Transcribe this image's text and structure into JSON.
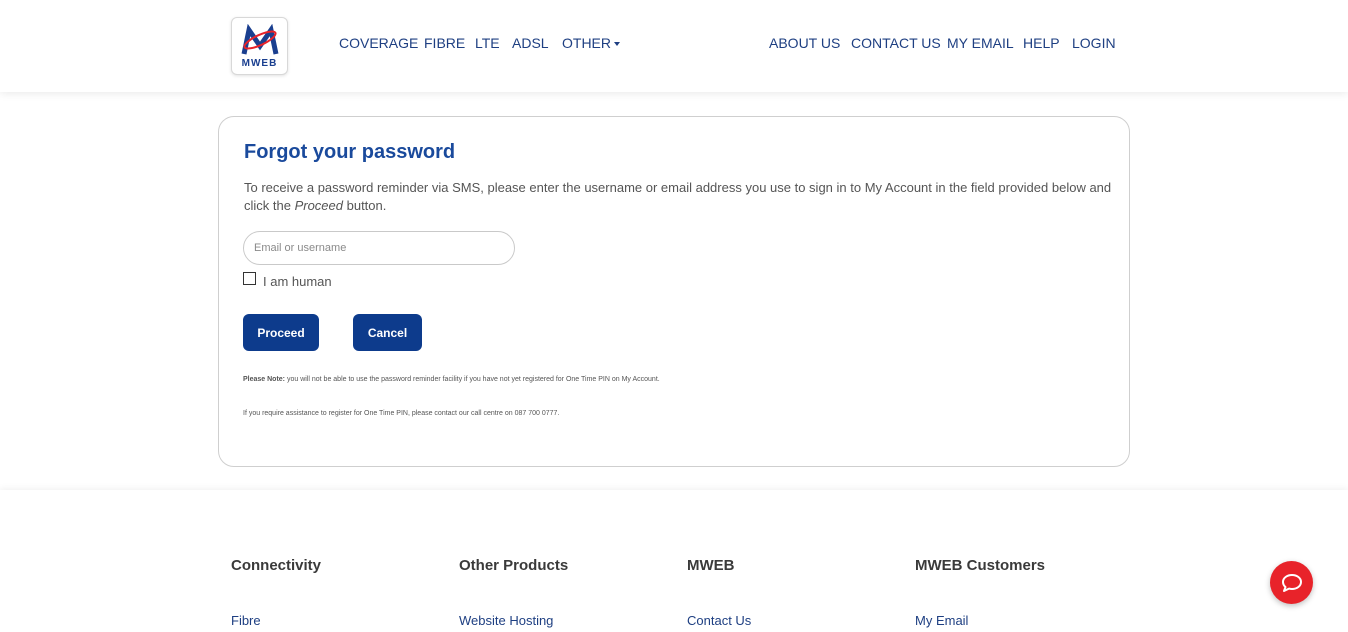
{
  "brand": {
    "logo_text": "MWEB"
  },
  "nav": {
    "left": [
      "COVERAGE",
      "FIBRE",
      "LTE",
      "ADSL",
      "OTHER"
    ],
    "right": [
      "ABOUT US",
      "CONTACT US",
      "MY EMAIL",
      "HELP",
      "LOGIN"
    ]
  },
  "form": {
    "title": "Forgot your password",
    "intro_before": "To receive a password reminder via SMS, please enter the username or email address you use to sign in to My Account in the field provided below and click the ",
    "intro_em": "Proceed",
    "intro_after": " button.",
    "input_placeholder": "Email or username",
    "input_value": "",
    "checkbox_label": "I am human",
    "checkbox_checked": false,
    "proceed_label": "Proceed",
    "cancel_label": "Cancel",
    "note_bold": "Please Note:",
    "note_text": " you will not be able to use the password reminder facility if you have not yet registered for One Time PIN on My Account.",
    "assist_text": "If you require assistance to register for One Time PIN, please contact our call centre on 087 700 0777."
  },
  "footer": {
    "columns": [
      {
        "heading": "Connectivity",
        "first_link": "Fibre"
      },
      {
        "heading": "Other Products",
        "first_link": "Website Hosting"
      },
      {
        "heading": "MWEB",
        "first_link": "Contact Us"
      },
      {
        "heading": "MWEB Customers",
        "first_link": "My Email"
      }
    ]
  },
  "colors": {
    "brand_blue": "#0d3b8c",
    "nav_blue": "#1e3f82",
    "title_blue": "#1a4a9c",
    "chat_red": "#e8232a"
  },
  "icons": {
    "chat": "chat-bubble-icon",
    "dropdown": "caret-down-icon"
  }
}
